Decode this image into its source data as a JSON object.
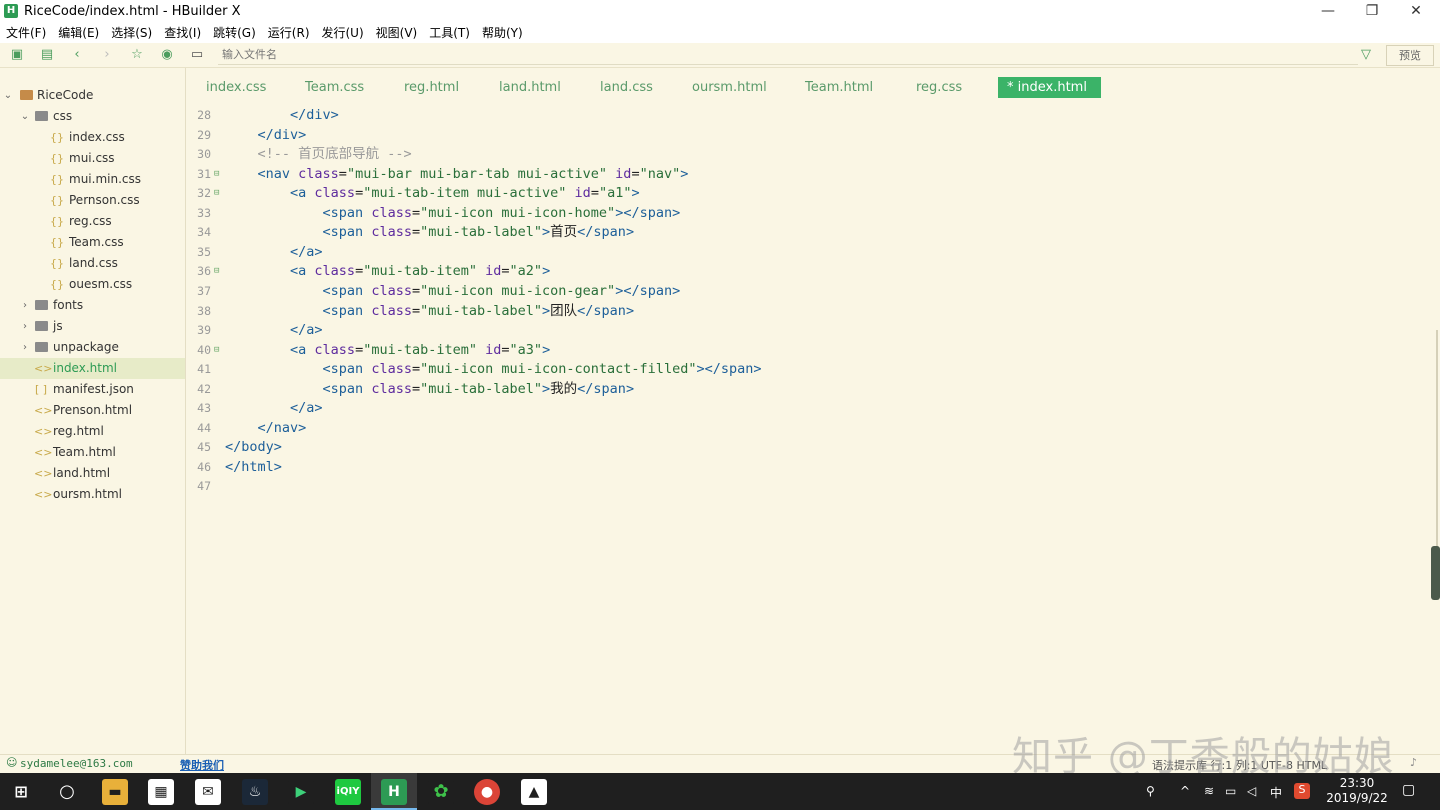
{
  "window": {
    "title": "RiceCode/index.html - HBuilder X",
    "app_icon": "H",
    "minimize": "—",
    "maximize": "❐",
    "close": "✕"
  },
  "menu": [
    "文件(F)",
    "编辑(E)",
    "选择(S)",
    "查找(I)",
    "跳转(G)",
    "运行(R)",
    "发行(U)",
    "视图(V)",
    "工具(T)",
    "帮助(Y)"
  ],
  "toolbar": {
    "search_placeholder": "输入文件名",
    "preview_label": "预览"
  },
  "sidebar": {
    "root": "RiceCode",
    "items": [
      {
        "label": "css",
        "type": "folder-open"
      },
      {
        "label": "index.css",
        "type": "css"
      },
      {
        "label": "mui.css",
        "type": "css"
      },
      {
        "label": "mui.min.css",
        "type": "css"
      },
      {
        "label": "Pernson.css",
        "type": "css"
      },
      {
        "label": "reg.css",
        "type": "css"
      },
      {
        "label": "Team.css",
        "type": "css"
      },
      {
        "label": "land.css",
        "type": "css"
      },
      {
        "label": "ouesm.css",
        "type": "css"
      },
      {
        "label": "fonts",
        "type": "folder"
      },
      {
        "label": "js",
        "type": "folder"
      },
      {
        "label": "unpackage",
        "type": "folder"
      },
      {
        "label": "index.html",
        "type": "html",
        "active": true
      },
      {
        "label": "manifest.json",
        "type": "json"
      },
      {
        "label": "Prenson.html",
        "type": "html"
      },
      {
        "label": "reg.html",
        "type": "html"
      },
      {
        "label": "Team.html",
        "type": "html"
      },
      {
        "label": "land.html",
        "type": "html"
      },
      {
        "label": "oursm.html",
        "type": "html"
      }
    ]
  },
  "tabs": [
    {
      "label": "index.css"
    },
    {
      "label": "Team.css"
    },
    {
      "label": "reg.html"
    },
    {
      "label": "land.html"
    },
    {
      "label": "land.css"
    },
    {
      "label": "oursm.html"
    },
    {
      "label": "Team.html"
    },
    {
      "label": "reg.css"
    },
    {
      "label": "* index.html",
      "active": true
    }
  ],
  "editor": {
    "lines": [
      {
        "n": "28",
        "fold": false,
        "segs": [
          [
            "txt",
            "        "
          ],
          [
            "tag",
            "</div>"
          ]
        ]
      },
      {
        "n": "29",
        "fold": false,
        "segs": [
          [
            "txt",
            "    "
          ],
          [
            "tag",
            "</div>"
          ]
        ]
      },
      {
        "n": "30",
        "fold": false,
        "segs": [
          [
            "txt",
            "    "
          ],
          [
            "cmt",
            "<!-- 首页底部导航 -->"
          ]
        ]
      },
      {
        "n": "31",
        "fold": true,
        "segs": [
          [
            "txt",
            "    "
          ],
          [
            "tag",
            "<nav "
          ],
          [
            "attr",
            "class"
          ],
          [
            "txt",
            "="
          ],
          [
            "str",
            "\"mui-bar mui-bar-tab mui-active\""
          ],
          [
            "txt",
            " "
          ],
          [
            "attr",
            "id"
          ],
          [
            "txt",
            "="
          ],
          [
            "str",
            "\"nav\""
          ],
          [
            "tag",
            ">"
          ]
        ]
      },
      {
        "n": "32",
        "fold": true,
        "segs": [
          [
            "txt",
            "        "
          ],
          [
            "tag",
            "<a "
          ],
          [
            "attr",
            "class"
          ],
          [
            "txt",
            "="
          ],
          [
            "str",
            "\"mui-tab-item mui-active\""
          ],
          [
            "txt",
            " "
          ],
          [
            "attr",
            "id"
          ],
          [
            "txt",
            "="
          ],
          [
            "str",
            "\"a1\""
          ],
          [
            "tag",
            ">"
          ]
        ]
      },
      {
        "n": "33",
        "fold": false,
        "segs": [
          [
            "txt",
            "            "
          ],
          [
            "tag",
            "<span "
          ],
          [
            "attr",
            "class"
          ],
          [
            "txt",
            "="
          ],
          [
            "str",
            "\"mui-icon mui-icon-home\""
          ],
          [
            "tag",
            "></span>"
          ]
        ]
      },
      {
        "n": "34",
        "fold": false,
        "segs": [
          [
            "txt",
            "            "
          ],
          [
            "tag",
            "<span "
          ],
          [
            "attr",
            "class"
          ],
          [
            "txt",
            "="
          ],
          [
            "str",
            "\"mui-tab-label\""
          ],
          [
            "tag",
            ">"
          ],
          [
            "txt",
            "首页"
          ],
          [
            "tag",
            "</span>"
          ]
        ]
      },
      {
        "n": "35",
        "fold": false,
        "segs": [
          [
            "txt",
            "        "
          ],
          [
            "tag",
            "</a>"
          ]
        ]
      },
      {
        "n": "36",
        "fold": true,
        "segs": [
          [
            "txt",
            "        "
          ],
          [
            "tag",
            "<a "
          ],
          [
            "attr",
            "class"
          ],
          [
            "txt",
            "="
          ],
          [
            "str",
            "\"mui-tab-item\""
          ],
          [
            "txt",
            " "
          ],
          [
            "attr",
            "id"
          ],
          [
            "txt",
            "="
          ],
          [
            "str",
            "\"a2\""
          ],
          [
            "tag",
            ">"
          ]
        ]
      },
      {
        "n": "37",
        "fold": false,
        "segs": [
          [
            "txt",
            "            "
          ],
          [
            "tag",
            "<span "
          ],
          [
            "attr",
            "class"
          ],
          [
            "txt",
            "="
          ],
          [
            "str",
            "\"mui-icon mui-icon-gear\""
          ],
          [
            "tag",
            "></span>"
          ]
        ]
      },
      {
        "n": "38",
        "fold": false,
        "segs": [
          [
            "txt",
            "            "
          ],
          [
            "tag",
            "<span "
          ],
          [
            "attr",
            "class"
          ],
          [
            "txt",
            "="
          ],
          [
            "str",
            "\"mui-tab-label\""
          ],
          [
            "tag",
            ">"
          ],
          [
            "txt",
            "团队"
          ],
          [
            "tag",
            "</span>"
          ]
        ]
      },
      {
        "n": "39",
        "fold": false,
        "segs": [
          [
            "txt",
            "        "
          ],
          [
            "tag",
            "</a>"
          ]
        ]
      },
      {
        "n": "40",
        "fold": true,
        "segs": [
          [
            "txt",
            "        "
          ],
          [
            "tag",
            "<a "
          ],
          [
            "attr",
            "class"
          ],
          [
            "txt",
            "="
          ],
          [
            "str",
            "\"mui-tab-item\""
          ],
          [
            "txt",
            " "
          ],
          [
            "attr",
            "id"
          ],
          [
            "txt",
            "="
          ],
          [
            "str",
            "\"a3\""
          ],
          [
            "tag",
            ">"
          ]
        ]
      },
      {
        "n": "41",
        "fold": false,
        "segs": [
          [
            "txt",
            "            "
          ],
          [
            "tag",
            "<span "
          ],
          [
            "attr",
            "class"
          ],
          [
            "txt",
            "="
          ],
          [
            "str",
            "\"mui-icon mui-icon-contact-filled\""
          ],
          [
            "tag",
            "></span>"
          ]
        ]
      },
      {
        "n": "42",
        "fold": false,
        "segs": [
          [
            "txt",
            "            "
          ],
          [
            "tag",
            "<span "
          ],
          [
            "attr",
            "class"
          ],
          [
            "txt",
            "="
          ],
          [
            "str",
            "\"mui-tab-label\""
          ],
          [
            "tag",
            ">"
          ],
          [
            "txt",
            "我的"
          ],
          [
            "tag",
            "</span>"
          ]
        ]
      },
      {
        "n": "43",
        "fold": false,
        "segs": [
          [
            "txt",
            "        "
          ],
          [
            "tag",
            "</a>"
          ]
        ]
      },
      {
        "n": "44",
        "fold": false,
        "segs": [
          [
            "txt",
            "    "
          ],
          [
            "tag",
            "</nav>"
          ]
        ]
      },
      {
        "n": "45",
        "fold": false,
        "segs": [
          [
            "tag",
            "</body>"
          ]
        ]
      },
      {
        "n": "46",
        "fold": false,
        "segs": [
          [
            "tag",
            "</html>"
          ]
        ]
      },
      {
        "n": "47",
        "fold": false,
        "segs": []
      }
    ]
  },
  "statusbar": {
    "user": "sydamelee@163.com",
    "help": "赞助我们",
    "right_text": "语法提示库   行:1   列:1   UTF-8   HTML"
  },
  "watermark": "知乎 @丁香般的姑娘",
  "taskbar": {
    "time": "23:30",
    "date": "2019/9/22",
    "ime": "中"
  },
  "colors": {
    "editor_bg": "#faf6e4",
    "accent": "#3bb368",
    "tag": "#1d5f99",
    "attr": "#5e2c9e",
    "string": "#2a6f3a"
  }
}
